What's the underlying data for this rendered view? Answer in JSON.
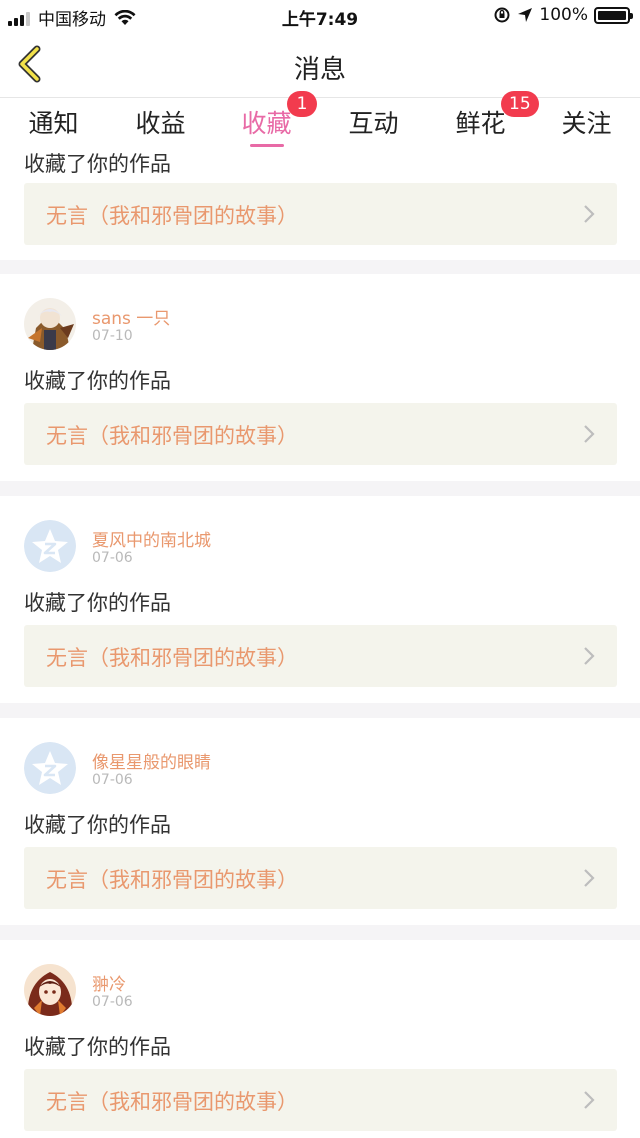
{
  "status_bar": {
    "carrier": "中国移动",
    "time": "上午7:49",
    "battery": "100%"
  },
  "nav": {
    "title": "消息"
  },
  "tabs": [
    {
      "label": "通知",
      "badge": ""
    },
    {
      "label": "收益",
      "badge": ""
    },
    {
      "label": "收藏",
      "badge": "1"
    },
    {
      "label": "互动",
      "badge": ""
    },
    {
      "label": "鲜花",
      "badge": "15"
    },
    {
      "label": "关注",
      "badge": ""
    }
  ],
  "active_tab_index": 2,
  "colors": {
    "accent_pink": "#e86aa6",
    "name_orange": "#e9986e",
    "badge_red": "#f23b4e"
  },
  "feed": {
    "partial_action": "收藏了你的作品",
    "partial_work_title": "无言（我和邪骨团的故事）",
    "items": [
      {
        "username": "sans 一只",
        "date": "07-10",
        "action": "收藏了你的作品",
        "work_title": "无言（我和邪骨团的故事）",
        "avatar": "anime-character-avatar"
      },
      {
        "username": "夏风中的南北城",
        "date": "07-06",
        "action": "收藏了你的作品",
        "work_title": "无言（我和邪骨团的故事）",
        "avatar": "default-star-avatar"
      },
      {
        "username": "像星星般的眼睛",
        "date": "07-06",
        "action": "收藏了你的作品",
        "work_title": "无言（我和邪骨团的故事）",
        "avatar": "default-star-avatar"
      },
      {
        "username": "翀冷",
        "date": "07-06",
        "action": "收藏了你的作品",
        "work_title": "无言（我和邪骨团的故事）",
        "avatar": "anime-girl-avatar"
      }
    ]
  }
}
